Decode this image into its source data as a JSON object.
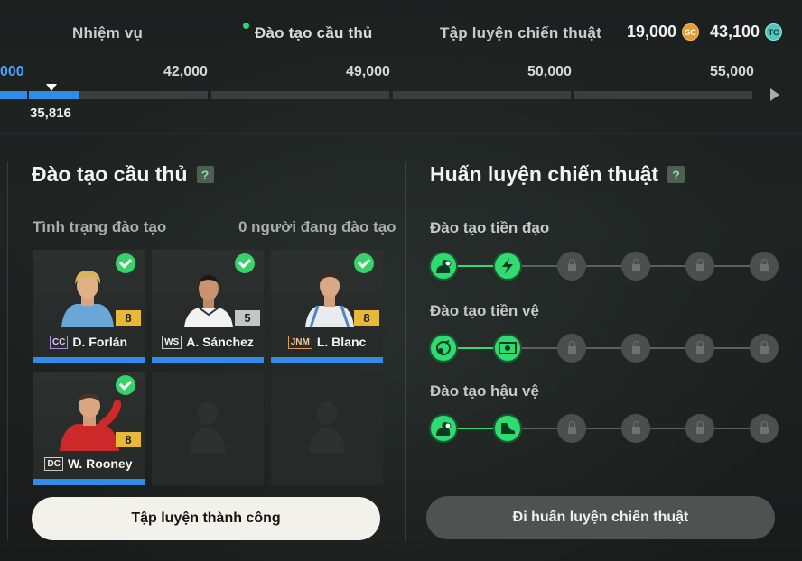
{
  "tabs": [
    {
      "label": "Nhiệm vụ"
    },
    {
      "label": "Đào tạo cầu thủ"
    },
    {
      "label": "Tập luyện chiến thuật"
    }
  ],
  "currency": {
    "sc_value": "19,000",
    "sc_icon": "SC",
    "tc_value": "43,100",
    "tc_icon": "TC"
  },
  "progress": {
    "milestones": [
      "000",
      "42,000",
      "49,000",
      "50,000",
      "55,000"
    ],
    "current": "35,816",
    "fill_fraction_of_first_segment": 0.28
  },
  "player_training": {
    "title": "Đào tạo cầu thủ",
    "help": "?",
    "status_label": "Tình trạng đào tạo",
    "status_value": "0 người đang đào tạo",
    "players": [
      {
        "pos": "CC",
        "name": "D. Forlán",
        "level": "8"
      },
      {
        "pos": "WS",
        "name": "A. Sánchez",
        "level": "5"
      },
      {
        "pos": "JNM",
        "name": "L. Blanc",
        "level": "8"
      },
      {
        "pos": "DC",
        "name": "W. Rooney",
        "level": "8"
      }
    ],
    "button": "Tập luyện thành công"
  },
  "tactical_training": {
    "title": "Huấn luyện chiến thuật",
    "help": "?",
    "tracks": [
      {
        "label": "Đào tạo tiền đạo",
        "unlocked": 2,
        "total": 6
      },
      {
        "label": "Đào tạo tiền vệ",
        "unlocked": 2,
        "total": 6
      },
      {
        "label": "Đào tạo hậu vệ",
        "unlocked": 2,
        "total": 6
      }
    ],
    "button": "Đi huấn luyện chiến thuật"
  },
  "colors": {
    "accent_green": "#2fdc72",
    "progress_blue": "#2f8de8",
    "level_gold": "#e8b838"
  }
}
